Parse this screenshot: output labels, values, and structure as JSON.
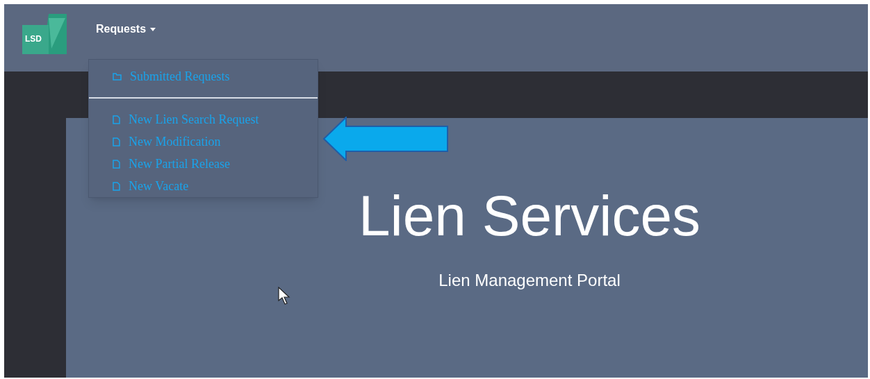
{
  "logo": {
    "text": "LSD"
  },
  "nav": {
    "label": "Requests",
    "expanded": true
  },
  "menu": {
    "sections": [
      [
        {
          "kind": "folder",
          "label": "Submitted Requests"
        }
      ],
      [
        {
          "kind": "file",
          "label": "New Lien Search Request"
        },
        {
          "kind": "file",
          "label": "New Modification"
        },
        {
          "kind": "file",
          "label": "New Partial Release"
        },
        {
          "kind": "file",
          "label": "New Vacate"
        }
      ]
    ]
  },
  "hero": {
    "title": "Lien Services",
    "subtitle": "Lien Management Portal"
  }
}
